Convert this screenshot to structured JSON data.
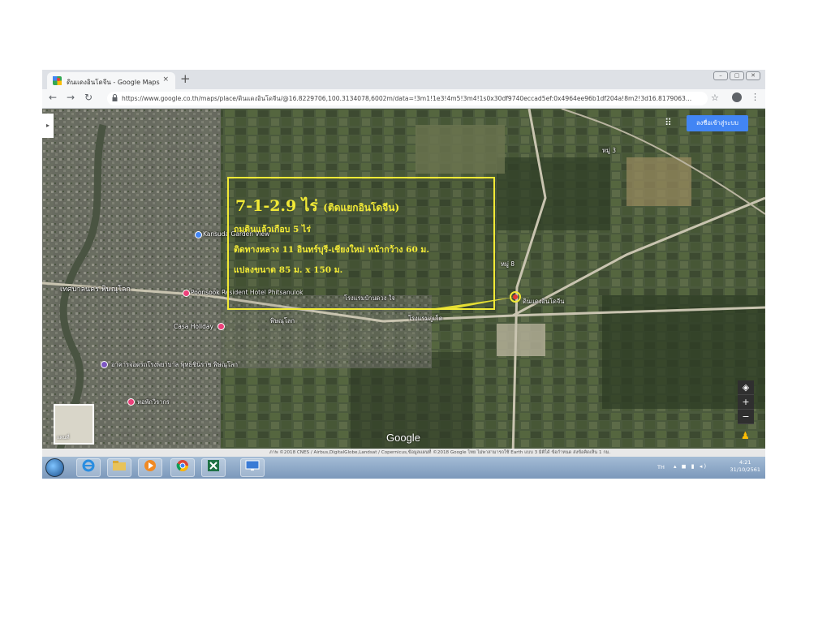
{
  "browser": {
    "tab_title": "ดินแดงอินโดจีน - Google Maps",
    "tab_close": "×",
    "new_tab": "+",
    "url": "https://www.google.co.th/maps/place/ดินแดงอินโดจีน/@16.8229706,100.3134078,6002m/data=!3m1!1e3!4m5!3m4!1s0x30df9740eccad5ef:0x4964ee96b1df204a!8m2!3d16.8179063..."
  },
  "map": {
    "signin_label": "ลงชื่อเข้าสู่ระบบ",
    "google_logo": "Google",
    "earth_label": "แผนที่",
    "attribution": "ภาพ ©2018 CNES / Airbus,DigitalGlobe,Landsat / Copernicus,ข้อมูลแผนที่ ©2018 Google    ไทย    ไม่พาสามารถใช้ Earth แบบ 3 มิติได้    ข้อกำหนด    ส่งข้อคิดเห็น    1 กม.",
    "places": [
      {
        "name": "Kansuda Garden View"
      },
      {
        "name": "Poonsook Resident Hotel Phitsanulok"
      },
      {
        "name": "Casa Holiday"
      },
      {
        "name": "พิษณุโลก"
      },
      {
        "name": "เทศบาลนคร พิษณุโลก"
      },
      {
        "name": "โรงแรมบ้านดวง ใจ"
      },
      {
        "name": "โรงแรมภูเก็ต"
      },
      {
        "name": "หมู่ 8"
      },
      {
        "name": "หมู่ 3"
      },
      {
        "name": "ดินแดงอินโดจีน"
      },
      {
        "name": "อาคารจอดรถโรงพยาบาล พุทธชินราช พิษณุโลก"
      },
      {
        "name": "หอพักวิรากร"
      }
    ]
  },
  "callout": {
    "headline": "7-1-2.9 ไร่",
    "headline_note": "(ติดแยกอินโดจีน)",
    "line1": "ถมดินแล้วเกือบ 5 ไร่",
    "line2": "ติดทางหลวง 11 อินทร์บุรี-เชียงใหม่ หน้ากว้าง 60 ม.",
    "line3": "แปลงขนาด 85 ม. x 150 ม.",
    "color": "#f2ea36"
  },
  "taskbar": {
    "lang": "TH",
    "time": "4:21",
    "date": "31/10/2561"
  }
}
